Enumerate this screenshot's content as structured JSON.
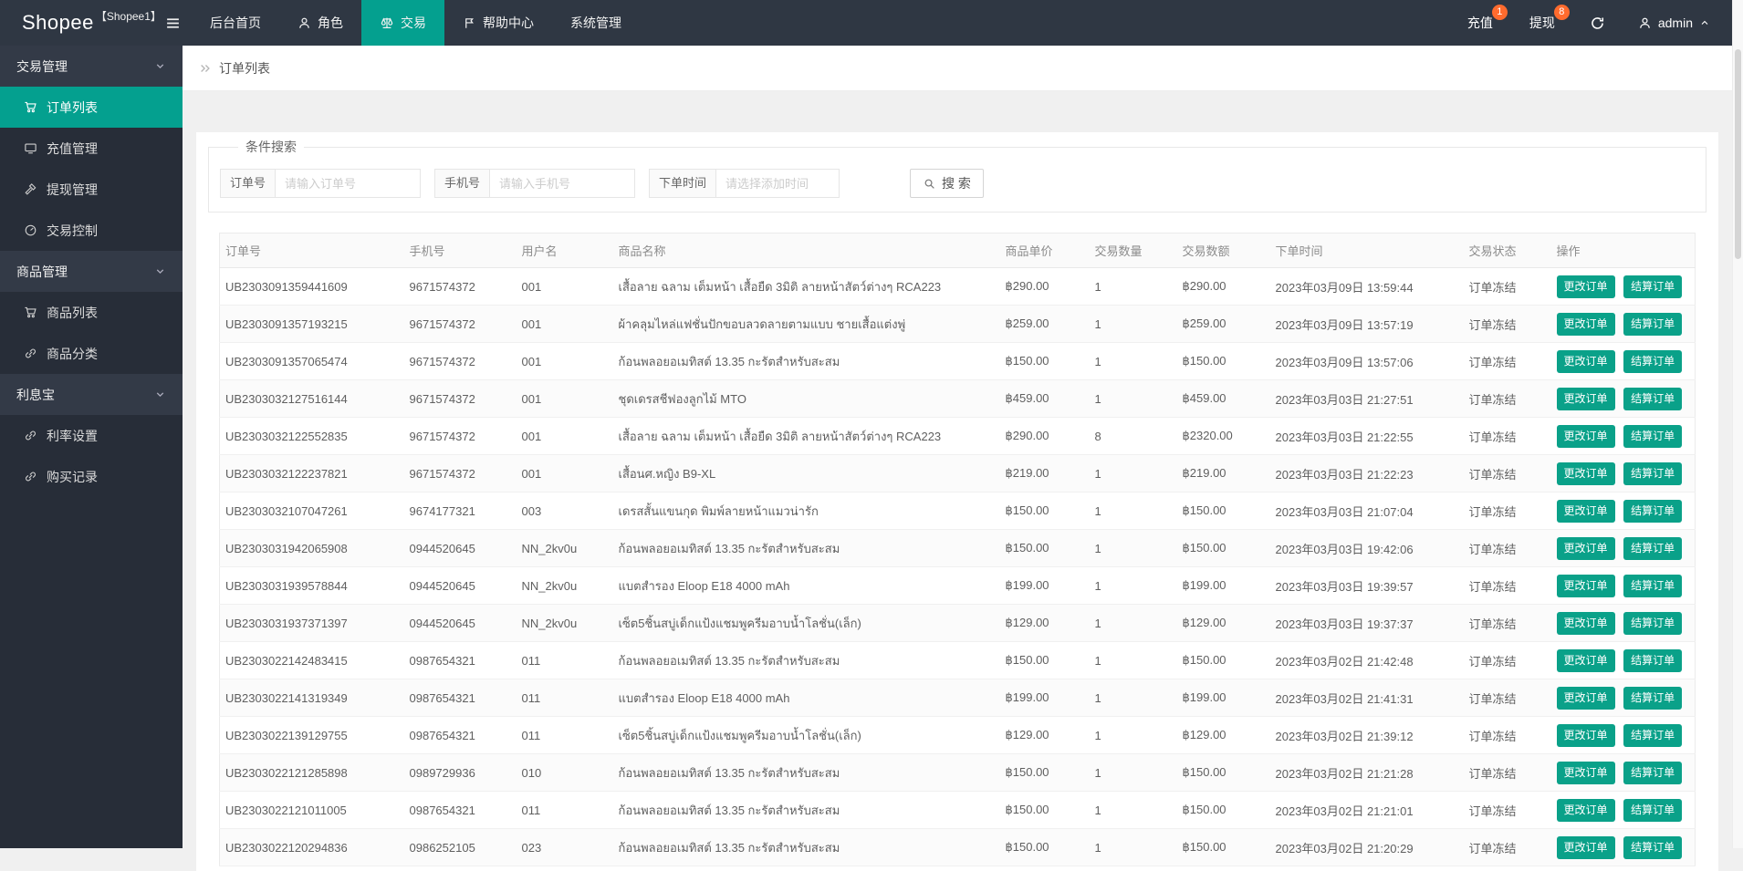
{
  "colors": {
    "accent_teal": "#04a08f",
    "button_teal": "#0aa189",
    "badge_orange": "#ff6b2e",
    "navbar_bg": "#2f3743",
    "sidebar_bg": "#272d38",
    "sidebar_header_bg": "#333a47"
  },
  "brand": {
    "name": "Shopee",
    "sub": "【Shopee1】"
  },
  "navbar": {
    "items": [
      {
        "label": "后台首页"
      },
      {
        "label": "角色",
        "icon": "user-icon"
      },
      {
        "label": "交易",
        "icon": "scales-icon",
        "active": true
      },
      {
        "label": "帮助中心",
        "icon": "flag-icon"
      },
      {
        "label": "系统管理"
      }
    ],
    "right": [
      {
        "label": "充值",
        "badge": "1"
      },
      {
        "label": "提现",
        "badge": "8"
      }
    ],
    "user": "admin"
  },
  "sidebar": {
    "items": [
      {
        "label": "交易管理",
        "type": "header"
      },
      {
        "label": "订单列表",
        "type": "item",
        "icon": "cart-icon",
        "active": true
      },
      {
        "label": "充值管理",
        "type": "item",
        "icon": "card-icon"
      },
      {
        "label": "提现管理",
        "type": "item",
        "icon": "hammer-icon"
      },
      {
        "label": "交易控制",
        "type": "item",
        "icon": "gauge-icon"
      },
      {
        "label": "商品管理",
        "type": "header"
      },
      {
        "label": "商品列表",
        "type": "item",
        "icon": "cart-icon"
      },
      {
        "label": "商品分类",
        "type": "item",
        "icon": "link-icon"
      },
      {
        "label": "利息宝",
        "type": "header"
      },
      {
        "label": "利率设置",
        "type": "item",
        "icon": "link-icon"
      },
      {
        "label": "购买记录",
        "type": "item",
        "icon": "link-icon"
      }
    ]
  },
  "breadcrumb": {
    "current": "订单列表"
  },
  "search": {
    "legend": "条件搜索",
    "fields": [
      {
        "label": "订单号",
        "placeholder": "请输入订单号"
      },
      {
        "label": "手机号",
        "placeholder": "请输入手机号"
      },
      {
        "label": "下单时间",
        "placeholder": "请选择添加时间"
      }
    ],
    "button_label": "搜 索"
  },
  "table": {
    "columns": [
      "订单号",
      "手机号",
      "用户名",
      "商品名称",
      "商品单价",
      "交易数量",
      "交易数额",
      "下单时间",
      "交易状态",
      "操作"
    ],
    "actions": [
      "更改订单",
      "结算订单"
    ],
    "rows": [
      {
        "order_no": "UB2303091359441609",
        "phone": "9671574372",
        "username": "001",
        "product": "เสื้อลาย ฉลาม เต็มหน้า เสื้อยืด 3มิติ ลายหน้าสัตว์ต่างๆ RCA223",
        "price": "฿290.00",
        "qty": "1",
        "amount": "฿290.00",
        "time": "2023年03月09日 13:59:44",
        "status": "订单冻结"
      },
      {
        "order_no": "UB2303091357193215",
        "phone": "9671574372",
        "username": "001",
        "product": "ผ้าคลุมไหล่แฟชั่นปักขอบลวดลายตามแบบ ชายเสื้อแต่งพู่",
        "price": "฿259.00",
        "qty": "1",
        "amount": "฿259.00",
        "time": "2023年03月09日 13:57:19",
        "status": "订单冻结"
      },
      {
        "order_no": "UB2303091357065474",
        "phone": "9671574372",
        "username": "001",
        "product": "ก้อนพลอยอเมทิสต์ 13.35 กะรัตสำหรับสะสม",
        "price": "฿150.00",
        "qty": "1",
        "amount": "฿150.00",
        "time": "2023年03月09日 13:57:06",
        "status": "订单冻结"
      },
      {
        "order_no": "UB2303032127516144",
        "phone": "9671574372",
        "username": "001",
        "product": "ชุดเดรสชีฟองลูกไม้ MTO",
        "price": "฿459.00",
        "qty": "1",
        "amount": "฿459.00",
        "time": "2023年03月03日 21:27:51",
        "status": "订单冻结"
      },
      {
        "order_no": "UB2303032122552835",
        "phone": "9671574372",
        "username": "001",
        "product": "เสื้อลาย ฉลาม เต็มหน้า เสื้อยืด 3มิติ ลายหน้าสัตว์ต่างๆ RCA223",
        "price": "฿290.00",
        "qty": "8",
        "amount": "฿2320.00",
        "time": "2023年03月03日 21:22:55",
        "status": "订单冻结"
      },
      {
        "order_no": "UB2303032122237821",
        "phone": "9671574372",
        "username": "001",
        "product": "เสื้อนศ.หญิง B9-XL",
        "price": "฿219.00",
        "qty": "1",
        "amount": "฿219.00",
        "time": "2023年03月03日 21:22:23",
        "status": "订单冻结"
      },
      {
        "order_no": "UB2303032107047261",
        "phone": "9674177321",
        "username": "003",
        "product": "เดรสสั้นแขนกุด พิมพ์ลายหน้าแมวน่ารัก",
        "price": "฿150.00",
        "qty": "1",
        "amount": "฿150.00",
        "time": "2023年03月03日 21:07:04",
        "status": "订单冻结"
      },
      {
        "order_no": "UB2303031942065908",
        "phone": "0944520645",
        "username": "NN_2kv0u",
        "product": "ก้อนพลอยอเมทิสต์ 13.35 กะรัตสำหรับสะสม",
        "price": "฿150.00",
        "qty": "1",
        "amount": "฿150.00",
        "time": "2023年03月03日 19:42:06",
        "status": "订单冻结"
      },
      {
        "order_no": "UB2303031939578844",
        "phone": "0944520645",
        "username": "NN_2kv0u",
        "product": "แบตสำรอง Eloop E18 4000 mAh",
        "price": "฿199.00",
        "qty": "1",
        "amount": "฿199.00",
        "time": "2023年03月03日 19:39:57",
        "status": "订单冻结"
      },
      {
        "order_no": "UB2303031937371397",
        "phone": "0944520645",
        "username": "NN_2kv0u",
        "product": "เซ็ต5ชิ้นสบู่เด็กแป้งแชมพูครีมอาบน้ำโลชั่น(เล็ก)",
        "price": "฿129.00",
        "qty": "1",
        "amount": "฿129.00",
        "time": "2023年03月03日 19:37:37",
        "status": "订单冻结"
      },
      {
        "order_no": "UB2303022142483415",
        "phone": "0987654321",
        "username": "011",
        "product": "ก้อนพลอยอเมทิสต์ 13.35 กะรัตสำหรับสะสม",
        "price": "฿150.00",
        "qty": "1",
        "amount": "฿150.00",
        "time": "2023年03月02日 21:42:48",
        "status": "订单冻结"
      },
      {
        "order_no": "UB2303022141319349",
        "phone": "0987654321",
        "username": "011",
        "product": "แบตสำรอง Eloop E18 4000 mAh",
        "price": "฿199.00",
        "qty": "1",
        "amount": "฿199.00",
        "time": "2023年03月02日 21:41:31",
        "status": "订单冻结"
      },
      {
        "order_no": "UB2303022139129755",
        "phone": "0987654321",
        "username": "011",
        "product": "เซ็ต5ชิ้นสบู่เด็กแป้งแชมพูครีมอาบน้ำโลชั่น(เล็ก)",
        "price": "฿129.00",
        "qty": "1",
        "amount": "฿129.00",
        "time": "2023年03月02日 21:39:12",
        "status": "订单冻结"
      },
      {
        "order_no": "UB2303022121285898",
        "phone": "0989729936",
        "username": "010",
        "product": "ก้อนพลอยอเมทิสต์ 13.35 กะรัตสำหรับสะสม",
        "price": "฿150.00",
        "qty": "1",
        "amount": "฿150.00",
        "time": "2023年03月02日 21:21:28",
        "status": "订单冻结"
      },
      {
        "order_no": "UB2303022121011005",
        "phone": "0987654321",
        "username": "011",
        "product": "ก้อนพลอยอเมทิสต์ 13.35 กะรัตสำหรับสะสม",
        "price": "฿150.00",
        "qty": "1",
        "amount": "฿150.00",
        "time": "2023年03月02日 21:21:01",
        "status": "订单冻结"
      },
      {
        "order_no": "UB2303022120294836",
        "phone": "0986252105",
        "username": "023",
        "product": "ก้อนพลอยอเมทิสต์ 13.35 กะรัตสำหรับสะสม",
        "price": "฿150.00",
        "qty": "1",
        "amount": "฿150.00",
        "time": "2023年03月02日 21:20:29",
        "status": "订单冻结"
      }
    ]
  }
}
